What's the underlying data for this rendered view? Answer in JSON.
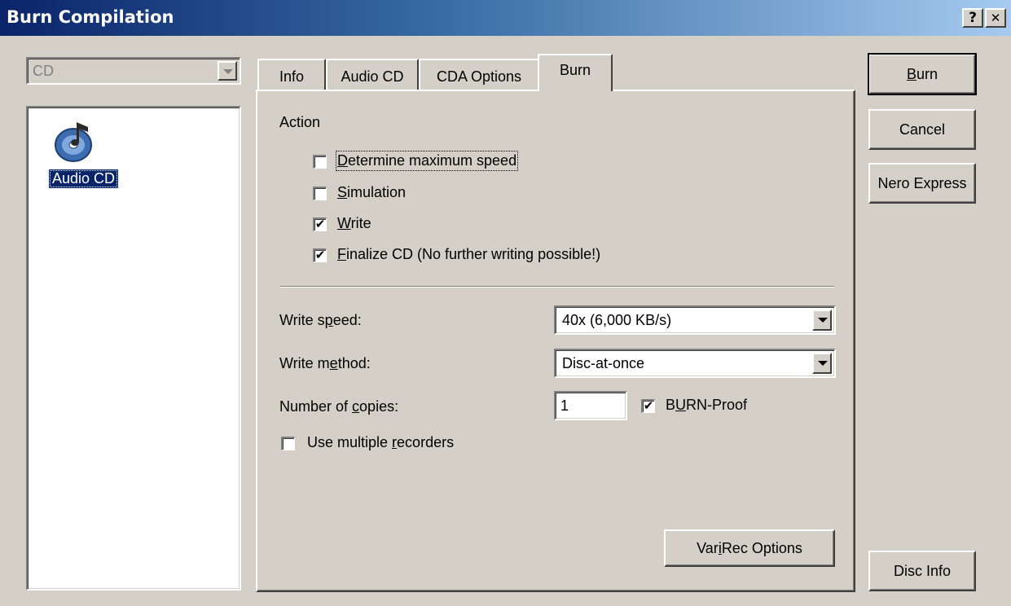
{
  "window": {
    "title": "Burn Compilation",
    "help_btn": "?",
    "close_btn": "✕"
  },
  "left": {
    "disc_type": "CD",
    "items": [
      {
        "label": "Audio CD",
        "icon": "audio-cd-icon"
      }
    ]
  },
  "tabs": [
    {
      "label": "Info",
      "active": false
    },
    {
      "label": "Audio CD",
      "active": false
    },
    {
      "label": "CDA Options",
      "active": false
    },
    {
      "label": "Burn",
      "active": true
    }
  ],
  "burn": {
    "action_label": "Action",
    "actions": [
      {
        "hot": "D",
        "rest": "etermine maximum speed",
        "checked": false
      },
      {
        "hot": "S",
        "rest": "imulation",
        "checked": false
      },
      {
        "hot": "W",
        "rest": "rite",
        "checked": true
      },
      {
        "hot": "F",
        "rest": "inalize CD (No further writing possible!)",
        "checked": true
      }
    ],
    "write_speed": {
      "pre": "Write s",
      "hot": "p",
      "post": "eed:",
      "value": "40x (6,000 KB/s)"
    },
    "write_method": {
      "pre": "Write m",
      "hot": "e",
      "post": "thod:",
      "value": "Disc-at-once"
    },
    "copies": {
      "pre": "Number of ",
      "hot": "c",
      "post": "opies:",
      "value": "1"
    },
    "burn_proof": {
      "pre": "B",
      "hot": "U",
      "post": "RN-Proof",
      "checked": true
    },
    "multi_rec": {
      "pre": "Use multiple ",
      "hot": "r",
      "post": "ecorders",
      "checked": false
    },
    "varirec": {
      "pre": "Var",
      "hot": "i",
      "post": "Rec Options"
    }
  },
  "buttons": {
    "burn_hot": "B",
    "burn_rest": "urn",
    "cancel": "Cancel",
    "nero_express": "Nero Express",
    "disc_info": "Disc Info"
  }
}
